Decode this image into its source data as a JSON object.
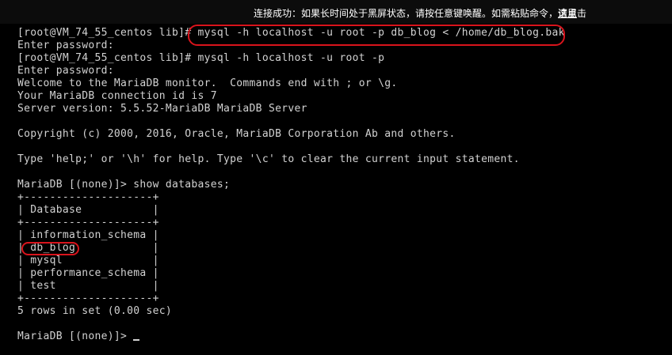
{
  "banner": {
    "message": "连接成功：如果长时间处于黑屏状态，请按任意键唤醒。如需粘贴命令，请点击",
    "link_label": "这里"
  },
  "terminal": {
    "lines": [
      "[root@VM_74_55_centos lib]# mysql -h localhost -u root -p db_blog < /home/db_blog.bak",
      "Enter password:",
      "[root@VM_74_55_centos lib]# mysql -h localhost -u root -p",
      "Enter password:",
      "Welcome to the MariaDB monitor.  Commands end with ; or \\g.",
      "Your MariaDB connection id is 7",
      "Server version: 5.5.52-MariaDB MariaDB Server",
      "",
      "Copyright (c) 2000, 2016, Oracle, MariaDB Corporation Ab and others.",
      "",
      "Type 'help;' or '\\h' for help. Type '\\c' to clear the current input statement.",
      "",
      "MariaDB [(none)]> show databases;",
      "+--------------------+",
      "| Database           |",
      "+--------------------+",
      "| information_schema |",
      "| db_blog            |",
      "| mysql              |",
      "| performance_schema |",
      "| test               |",
      "+--------------------+",
      "5 rows in set (0.00 sec)",
      "",
      "MariaDB [(none)]> "
    ]
  },
  "colors": {
    "background": "#000000",
    "text": "#d2d2d2",
    "highlight": "#d9141c",
    "banner_text": "#ffffff"
  }
}
